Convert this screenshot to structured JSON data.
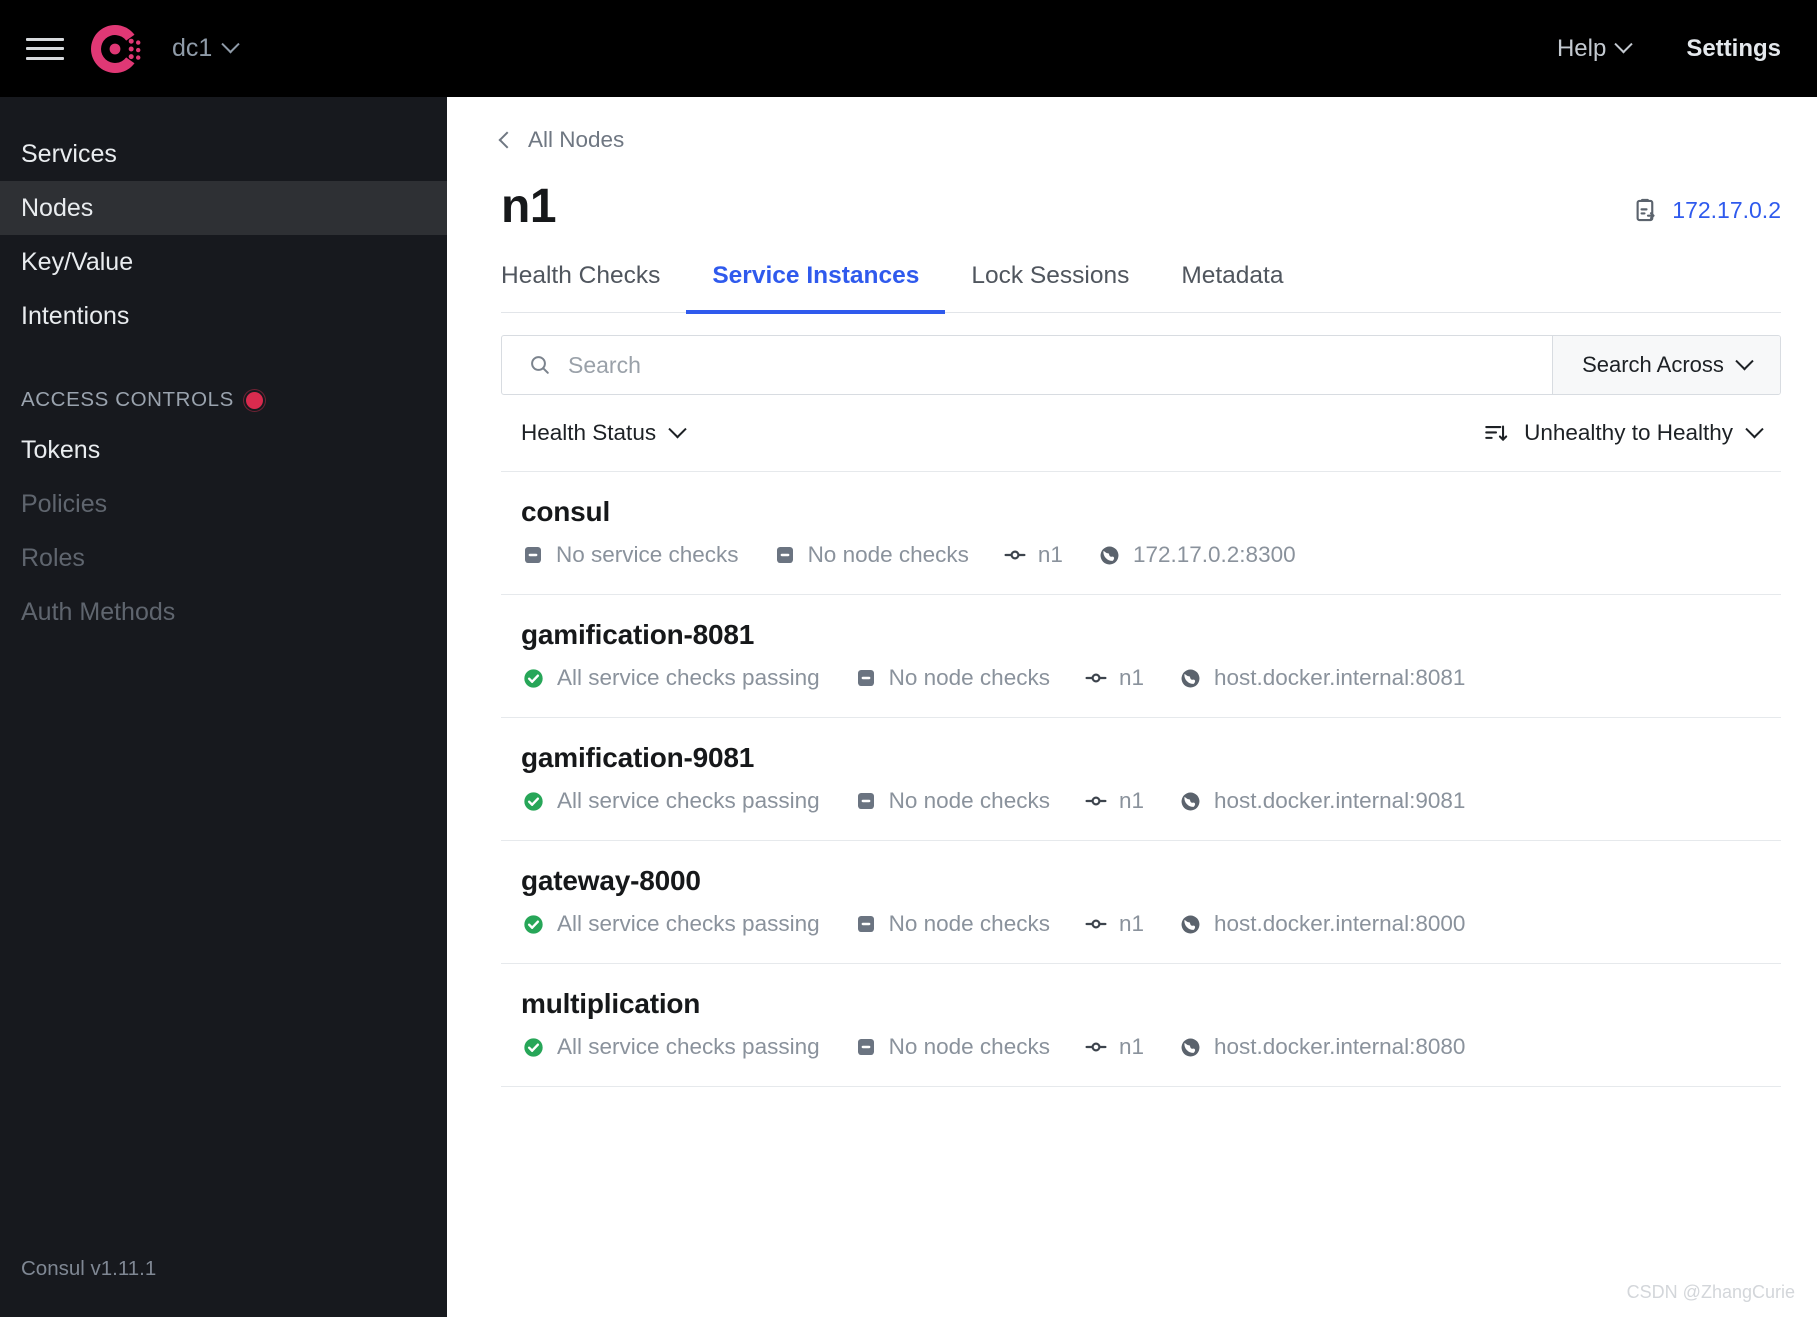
{
  "topbar": {
    "menu_icon": "hamburger-icon",
    "logo_icon": "consul-logo-icon",
    "datacenter": "dc1",
    "help_label": "Help",
    "settings_label": "Settings"
  },
  "sidebar": {
    "items": [
      {
        "label": "Services",
        "active": false,
        "disabled": false
      },
      {
        "label": "Nodes",
        "active": true,
        "disabled": false
      },
      {
        "label": "Key/Value",
        "active": false,
        "disabled": false
      },
      {
        "label": "Intentions",
        "active": false,
        "disabled": false
      }
    ],
    "section_label": "ACCESS CONTROLS",
    "section_badge": "red-dot-icon",
    "acl_items": [
      {
        "label": "Tokens",
        "disabled": false
      },
      {
        "label": "Policies",
        "disabled": true
      },
      {
        "label": "Roles",
        "disabled": true
      },
      {
        "label": "Auth Methods",
        "disabled": true
      }
    ],
    "version": "Consul v1.11.1"
  },
  "main": {
    "breadcrumb": "All Nodes",
    "back_icon": "chevron-left-icon",
    "title": "n1",
    "ip_badge": {
      "icon": "copy-to-clipboard-icon",
      "value": "172.17.0.2"
    },
    "tabs": [
      {
        "label": "Health Checks",
        "active": false
      },
      {
        "label": "Service Instances",
        "active": true
      },
      {
        "label": "Lock Sessions",
        "active": false
      },
      {
        "label": "Metadata",
        "active": false
      }
    ],
    "search": {
      "icon": "search-icon",
      "placeholder": "Search",
      "value": "",
      "across_label": "Search Across"
    },
    "filters": {
      "health_status_label": "Health Status",
      "sort_icon": "sort-descending-icon",
      "sort_label": "Unhealthy to Healthy"
    },
    "services": [
      {
        "name": "consul",
        "service_check": {
          "icon": "minus-square-icon",
          "status": "none",
          "label": "No service checks"
        },
        "node_check": {
          "icon": "minus-square-icon",
          "status": "none",
          "label": "No node checks"
        },
        "node": {
          "icon": "node-icon",
          "label": "n1"
        },
        "address": {
          "icon": "globe-icon",
          "label": "172.17.0.2:8300"
        }
      },
      {
        "name": "gamification-8081",
        "service_check": {
          "icon": "check-circle-icon",
          "status": "passing",
          "label": "All service checks passing"
        },
        "node_check": {
          "icon": "minus-square-icon",
          "status": "none",
          "label": "No node checks"
        },
        "node": {
          "icon": "node-icon",
          "label": "n1"
        },
        "address": {
          "icon": "globe-icon",
          "label": "host.docker.internal:8081"
        }
      },
      {
        "name": "gamification-9081",
        "service_check": {
          "icon": "check-circle-icon",
          "status": "passing",
          "label": "All service checks passing"
        },
        "node_check": {
          "icon": "minus-square-icon",
          "status": "none",
          "label": "No node checks"
        },
        "node": {
          "icon": "node-icon",
          "label": "n1"
        },
        "address": {
          "icon": "globe-icon",
          "label": "host.docker.internal:9081"
        }
      },
      {
        "name": "gateway-8000",
        "service_check": {
          "icon": "check-circle-icon",
          "status": "passing",
          "label": "All service checks passing"
        },
        "node_check": {
          "icon": "minus-square-icon",
          "status": "none",
          "label": "No node checks"
        },
        "node": {
          "icon": "node-icon",
          "label": "n1"
        },
        "address": {
          "icon": "globe-icon",
          "label": "host.docker.internal:8000"
        }
      },
      {
        "name": "multiplication",
        "service_check": {
          "icon": "check-circle-icon",
          "status": "passing",
          "label": "All service checks passing"
        },
        "node_check": {
          "icon": "minus-square-icon",
          "status": "none",
          "label": "No node checks"
        },
        "node": {
          "icon": "node-icon",
          "label": "n1"
        },
        "address": {
          "icon": "globe-icon",
          "label": "host.docker.internal:8080"
        }
      }
    ]
  },
  "watermark": "CSDN @ZhangCurie",
  "colors": {
    "brand_pink": "#e03875",
    "accent_blue": "#2f5aed",
    "passing_green": "#27a658",
    "muted_gray": "#8a929c",
    "sidebar_bg": "#17191e",
    "sidebar_active": "#2e3034",
    "badge_red": "#d92b4e"
  }
}
